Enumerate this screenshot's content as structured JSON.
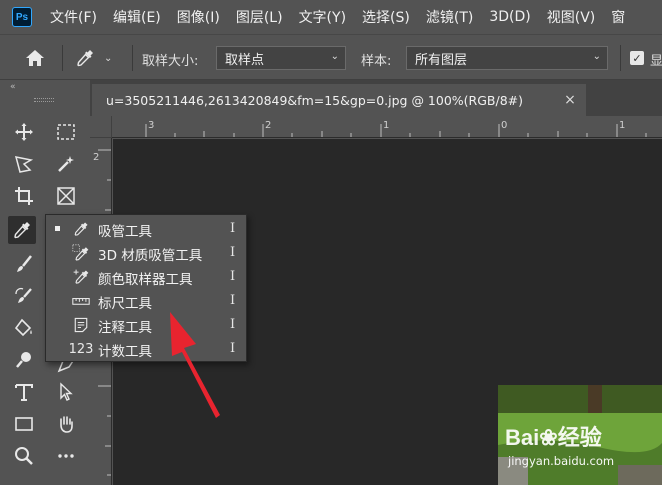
{
  "app": {
    "logo_text": "Ps"
  },
  "menu": [
    {
      "label": "文件(F)"
    },
    {
      "label": "编辑(E)"
    },
    {
      "label": "图像(I)"
    },
    {
      "label": "图层(L)"
    },
    {
      "label": "文字(Y)"
    },
    {
      "label": "选择(S)"
    },
    {
      "label": "滤镜(T)"
    },
    {
      "label": "3D(D)"
    },
    {
      "label": "视图(V)"
    },
    {
      "label": "窗"
    }
  ],
  "options_bar": {
    "sample_size_label": "取样大小:",
    "sample_size_value": "取样点",
    "sample_label": "样本:",
    "sample_value": "所有图层",
    "checkbox_trailing_text": "显"
  },
  "document": {
    "tab_title": "u=3505211446,2613420849&fm=15&gp=0.jpg @ 100%(RGB/8#)",
    "close_glyph": "×"
  },
  "rulers": {
    "horizontal": [
      "3",
      "2",
      "1",
      "0",
      "1"
    ],
    "vertical": [
      "2"
    ]
  },
  "flyout": {
    "items": [
      {
        "label": "吸管工具",
        "shortcut": "I",
        "selected": true,
        "icon": "eyedropper-icon"
      },
      {
        "label": "3D 材质吸管工具",
        "shortcut": "I",
        "selected": false,
        "icon": "3d-material-eyedropper-icon"
      },
      {
        "label": "颜色取样器工具",
        "shortcut": "I",
        "selected": false,
        "icon": "color-sampler-icon"
      },
      {
        "label": "标尺工具",
        "shortcut": "I",
        "selected": false,
        "icon": "ruler-icon"
      },
      {
        "label": "注释工具",
        "shortcut": "I",
        "selected": false,
        "icon": "note-icon"
      },
      {
        "label": "计数工具",
        "shortcut": "I",
        "selected": false,
        "icon": "count-icon"
      }
    ],
    "count_icon_glyph": "123"
  },
  "watermark": {
    "brand": "Bai",
    "brand_tail": "经验",
    "url": "jingyan.baidu.com"
  },
  "colors": {
    "ui_panel": "#535353",
    "canvas": "#282828",
    "arrow": "#e8242f",
    "ps_blue": "#31a8ff"
  }
}
